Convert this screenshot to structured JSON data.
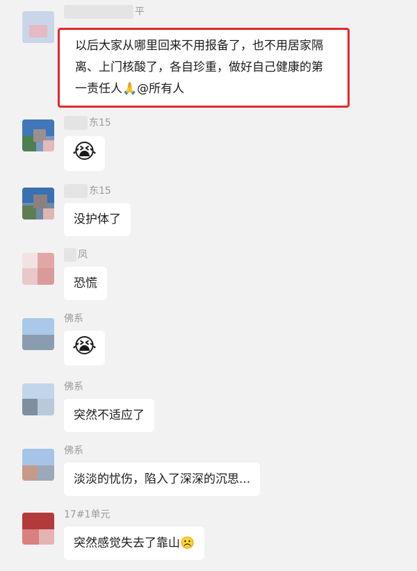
{
  "messages": [
    {
      "sender": "平",
      "text": "以后大家从哪里回来不用报备了，也不用居家隔离、上门核酸了，各自珍重，做好自己健康的第一责任人🙏@所有人",
      "highlighted": true
    },
    {
      "sender": "东15",
      "emoji": "😭"
    },
    {
      "sender": "东15",
      "text": "没护体了"
    },
    {
      "sender": "凤",
      "text": "恐慌"
    },
    {
      "sender": "佛系",
      "emoji": "😭"
    },
    {
      "sender": "佛系",
      "text": "突然不适应了"
    },
    {
      "sender": "佛系",
      "text": "淡淡的忧伤，陷入了深深的沉思..."
    },
    {
      "sender": "17#1单元",
      "text": "突然感觉失去了靠山☹️"
    }
  ],
  "colors": {
    "highlight_border": "#e3272b",
    "bubble": "#ffffff",
    "background": "#f2f2f2"
  }
}
